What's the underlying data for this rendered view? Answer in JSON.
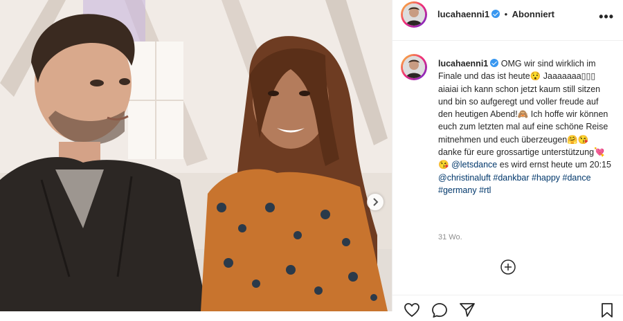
{
  "post": {
    "username": "lucahaenni1",
    "follow_status": "Abonniert",
    "more_label": "•••",
    "caption_username": "lucahaenni1",
    "caption_part1": "OMG wir sind wirklich im Finale und das ist heute😯 Jaaaaaaa▯▯▯ aiaiai ich kann schon jetzt kaum still sitzen und bin so aufgeregt und voller freude auf den heutigen Abend!🙈 Ich hoffe wir können euch zum letzten mal auf eine schöne Reise mitnehmen und euch überzeugen🤗😘 danke für eure grossartige unterstützung💘😘",
    "mention_letsdance": "@letsdance",
    "caption_part2": "es wird ernst heute um 20:15",
    "mention_christina": "@christinaluft",
    "tag_dankbar": "#dankbar",
    "tag_happy": "#happy",
    "tag_dance": "#dance",
    "tag_germany": "#germany",
    "tag_rtl": "#rtl",
    "timestamp": "31 Wo."
  },
  "icons": {
    "verified": "verified-badge-icon",
    "more": "more-options-icon",
    "next": "chevron-right-icon",
    "load_more": "plus-circle-icon",
    "like": "heart-icon",
    "comment": "comment-icon",
    "share": "send-icon",
    "save": "bookmark-icon"
  },
  "colors": {
    "link": "#00376b",
    "verified": "#3897f0",
    "muted": "#8e8e8e"
  }
}
